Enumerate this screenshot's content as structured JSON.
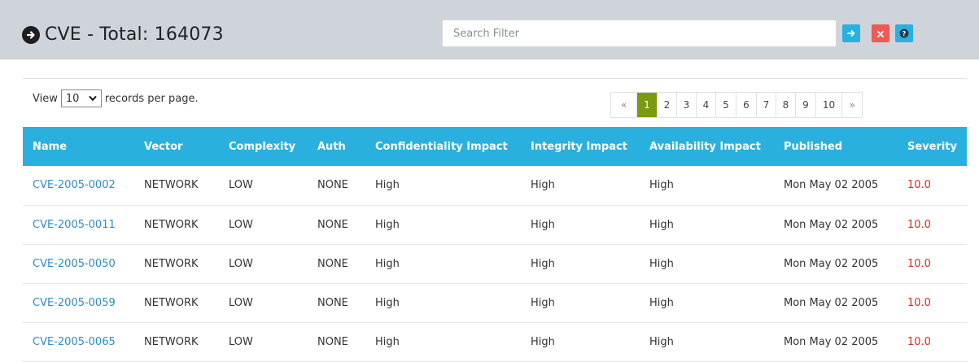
{
  "header": {
    "title": "CVE - Total: 164073",
    "search_placeholder": "Search Filter",
    "buttons": {
      "go": "→",
      "clear": "×",
      "help": "?"
    }
  },
  "controls": {
    "view_prefix": "View",
    "per_page": "10",
    "view_suffix": "records per page."
  },
  "pagination": {
    "prev": "«",
    "pages": [
      "1",
      "2",
      "3",
      "4",
      "5",
      "6",
      "7",
      "8",
      "9",
      "10"
    ],
    "current": "1",
    "next": "»"
  },
  "table": {
    "columns": [
      "Name",
      "Vector",
      "Complexity",
      "Auth",
      "Confidentiality Impact",
      "Integrity Impact",
      "Availability Impact",
      "Published",
      "Severity"
    ],
    "rows": [
      [
        "CVE-2005-0002",
        "NETWORK",
        "LOW",
        "NONE",
        "High",
        "High",
        "High",
        "Mon May 02 2005",
        "10.0"
      ],
      [
        "CVE-2005-0011",
        "NETWORK",
        "LOW",
        "NONE",
        "High",
        "High",
        "High",
        "Mon May 02 2005",
        "10.0"
      ],
      [
        "CVE-2005-0050",
        "NETWORK",
        "LOW",
        "NONE",
        "High",
        "High",
        "High",
        "Mon May 02 2005",
        "10.0"
      ],
      [
        "CVE-2005-0059",
        "NETWORK",
        "LOW",
        "NONE",
        "High",
        "High",
        "High",
        "Mon May 02 2005",
        "10.0"
      ],
      [
        "CVE-2005-0065",
        "NETWORK",
        "LOW",
        "NONE",
        "High",
        "High",
        "High",
        "Mon May 02 2005",
        "10.0"
      ]
    ]
  },
  "colors": {
    "header_bg": "#cfd3da",
    "accent": "#2ab0df",
    "danger": "#ee5b57",
    "active_page": "#7a9a0f",
    "severity": "#dd2a1b",
    "link": "#2a8ec4"
  }
}
